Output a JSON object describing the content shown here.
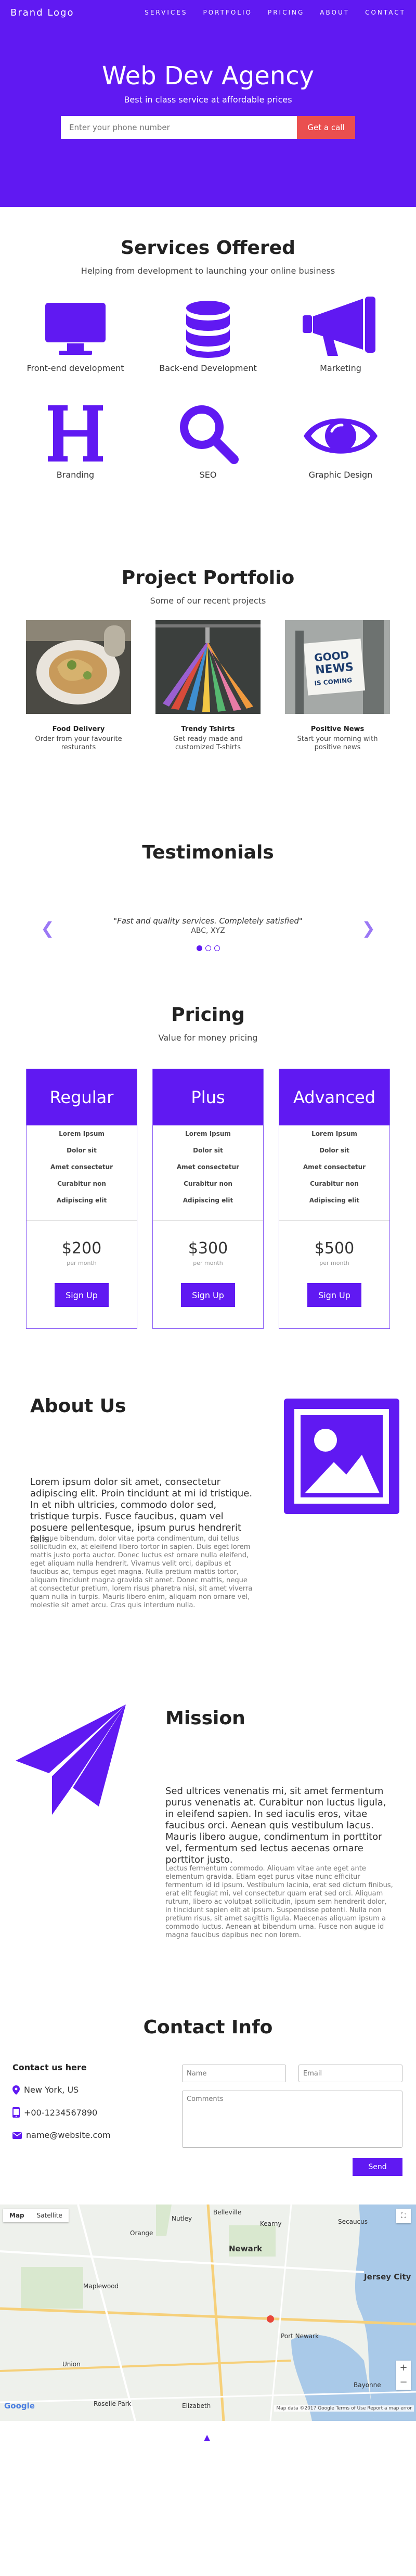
{
  "nav": {
    "brand": "Brand Logo",
    "items": [
      "SERVICES",
      "PORTFOLIO",
      "PRICING",
      "ABOUT",
      "CONTACT"
    ]
  },
  "hero": {
    "title": "Web Dev Agency",
    "subtitle": "Best in class service at affordable prices",
    "phone_placeholder": "Enter your phone number",
    "cta": "Get a call"
  },
  "services": {
    "title": "Services Offered",
    "subtitle": "Helping from development to launching your online business",
    "items": [
      {
        "label": "Front-end development",
        "icon": "monitor-icon"
      },
      {
        "label": "Back-end Development",
        "icon": "database-icon"
      },
      {
        "label": "Marketing",
        "icon": "megaphone-icon"
      },
      {
        "label": "Branding",
        "icon": "letter-h-icon"
      },
      {
        "label": "SEO",
        "icon": "search-icon"
      },
      {
        "label": "Graphic Design",
        "icon": "eye-icon"
      }
    ]
  },
  "portfolio": {
    "title": "Project Portfolio",
    "subtitle": "Some of our recent projects",
    "items": [
      {
        "title": "Food Delivery",
        "desc": "Order from your favourite resturants"
      },
      {
        "title": "Trendy Tshirts",
        "desc": "Get ready made and customized T-shirts"
      },
      {
        "title": "Positive News",
        "desc": "Start your morning with positive news",
        "sign_lines": [
          "GOOD",
          "NEWS",
          "IS COMING"
        ]
      }
    ]
  },
  "testimonials": {
    "title": "Testimonials",
    "quote": "\"Fast and quality services. Completely satisfied\"",
    "author": "ABC, XYZ",
    "prev": "❮",
    "next": "❯"
  },
  "pricing": {
    "title": "Pricing",
    "subtitle": "Value for money pricing",
    "plans": [
      {
        "name": "Regular",
        "features": [
          "Lorem Ipsum",
          "Dolor sit",
          "Amet consectetur",
          "Curabitur non",
          "Adipiscing elit"
        ],
        "price": "$200",
        "period": "per month",
        "cta": "Sign Up"
      },
      {
        "name": "Plus",
        "features": [
          "Lorem Ipsum",
          "Dolor sit",
          "Amet consectetur",
          "Curabitur non",
          "Adipiscing elit"
        ],
        "price": "$300",
        "period": "per month",
        "cta": "Sign Up"
      },
      {
        "name": "Advanced",
        "features": [
          "Lorem Ipsum",
          "Dolor sit",
          "Amet consectetur",
          "Curabitur non",
          "Adipiscing elit"
        ],
        "price": "$500",
        "period": "per month",
        "cta": "Sign Up"
      }
    ]
  },
  "about": {
    "title": "About Us",
    "lead": "Lorem ipsum dolor sit amet, consectetur adipiscing elit. Proin tincidunt at mi id tristique. In et nibh ultricies, commodo dolor sed, tristique turpis. Fusce faucibus, quam vel posuere pellentesque, ipsum purus hendrerit felis.",
    "body": "Quisque bibendum, dolor vitae porta condimentum, dui tellus sollicitudin ex, at eleifend libero tortor in sapien. Duis eget lorem mattis justo porta auctor. Donec luctus est ornare nulla eleifend, eget aliquam nulla hendrerit. Vivamus velit orci, dapibus et faucibus ac, tempus eget magna. Nulla pretium mattis tortor, aliquam tincidunt magna gravida sit amet. Donec mattis, neque at consectetur pretium, lorem risus pharetra nisi, sit amet viverra quam nulla in turpis. Mauris libero enim, aliquam non ornare vel, molestie sit amet arcu. Cras quis interdum nulla."
  },
  "mission": {
    "title": "Mission",
    "lead": "Sed ultrices venenatis mi, sit amet fermentum purus venenatis at. Curabitur non luctus ligula, in eleifend sapien. In sed iaculis eros, vitae faucibus orci. Aenean quis vestibulum lacus. Mauris libero augue, condimentum in porttitor vel, fermentum sed lectus aecenas ornare porttitor justo.",
    "body": "Lectus fermentum commodo. Aliquam vitae ante eget ante elementum gravida. Etiam eget purus vitae nunc efficitur fermentum id id ipsum. Vestibulum lacinia, erat sed dictum finibus, erat elit feugiat mi, vel consectetur quam erat sed orci. Aliquam rutrum, libero ac volutpat sollicitudin, ipsum sem hendrerit dolor, in tincidunt sapien elit at ipsum. Suspendisse potenti. Nulla non pretium risus, sit amet sagittis ligula. Maecenas aliquam ipsum a commodo luctus. Aenean at bibendum urna. Fusce non augue id magna faucibus dapibus nec non lorem."
  },
  "contact": {
    "title": "Contact Info",
    "heading": "Contact us here",
    "location": "New York, US",
    "phone": "+00-1234567890",
    "email": "name@website.com",
    "name_placeholder": "Name",
    "email_placeholder": "Email",
    "comments_placeholder": "Comments",
    "send": "Send"
  },
  "map": {
    "tabs": [
      "Map",
      "Satellite"
    ],
    "places": [
      "Newark",
      "Jersey City",
      "Elizabeth",
      "Bayonne",
      "Secaucus",
      "Kearny",
      "Belleville",
      "Nutley",
      "Orange",
      "Maplewood",
      "Union",
      "Roselle Park",
      "Port Newark"
    ],
    "attribution": "Map data ©2017 Google  Terms of Use  Report a map error",
    "google": "Google"
  },
  "footer": {
    "back_to_top": "▲"
  },
  "colors": {
    "primary": "#6019f2",
    "cta": "#ea4f4f"
  }
}
